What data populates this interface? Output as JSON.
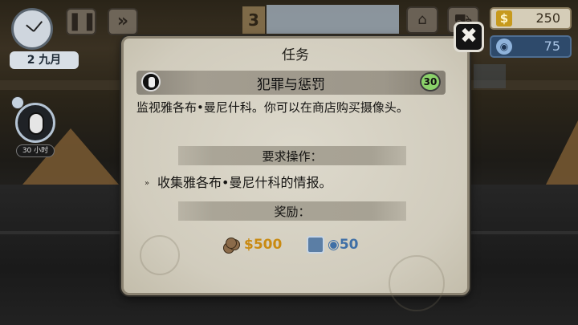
{
  "hud": {
    "date": "2 九月",
    "day_number": "3",
    "money": "250",
    "money_symbol": "$",
    "reputation": "75"
  },
  "side_task": {
    "time": "30 小时"
  },
  "dialog": {
    "title": "任务",
    "close_label": "✖",
    "task": {
      "name": "犯罪与惩罚",
      "time_badge": "30",
      "description": "监视雅各布•曼尼什科。你可以在商店购买摄像头。"
    },
    "requirements_heading": "要求操作：",
    "requirements": [
      {
        "text": "收集雅各布•曼尼什科的情报。"
      }
    ],
    "rewards_heading": "奖励：",
    "rewards": {
      "money": "$500",
      "reputation": "50"
    }
  },
  "colors": {
    "dialog_bg": "#d1ccbd",
    "money_reward": "#c98a12",
    "reputation_reward": "#3f6fa6",
    "time_badge": "#8bd26a"
  },
  "icons": {
    "task": "surveillance-eye-icon",
    "money": "coin-stack-icon",
    "reputation": "shield-icon"
  }
}
